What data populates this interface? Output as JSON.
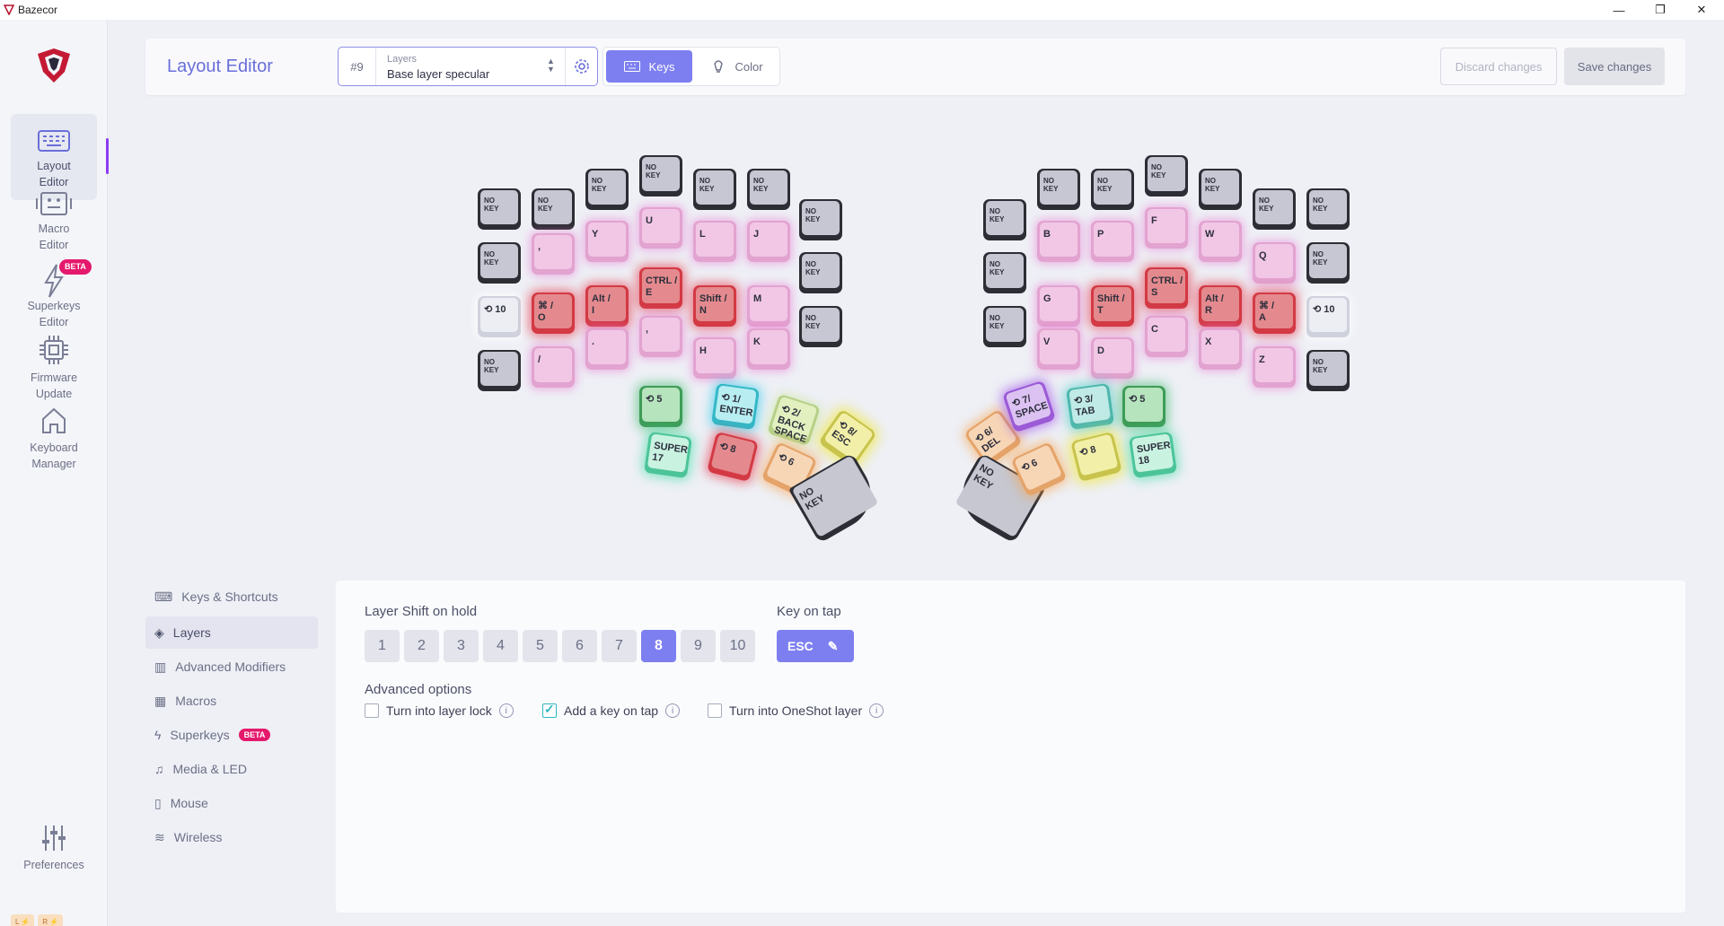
{
  "window": {
    "title": "Bazecor",
    "controls": {
      "minimize": "—",
      "maximize": "❐",
      "close": "✕"
    }
  },
  "nav": {
    "items": [
      {
        "label": "Layout\nEditor"
      },
      {
        "label": "Macro\nEditor"
      },
      {
        "label": "Superkeys\nEditor",
        "badge": "BETA"
      },
      {
        "label": "Firmware\nUpdate"
      },
      {
        "label": "Keyboard\nManager"
      }
    ],
    "preferences": "Preferences",
    "footer": [
      "L ⚡",
      "R ⚡"
    ]
  },
  "topbar": {
    "title": "Layout Editor",
    "layer_num": "#9",
    "layer_label": "Layers",
    "layer_value": "Base layer specular",
    "keys_label": "Keys",
    "color_label": "Color",
    "discard_label": "Discard changes",
    "save_label": "Save changes"
  },
  "config_menu": [
    {
      "label": "Keys & Shortcuts",
      "icon": "keyboard-icon"
    },
    {
      "label": "Layers",
      "icon": "layers-icon"
    },
    {
      "label": "Advanced Modifiers",
      "icon": "modifiers-icon"
    },
    {
      "label": "Macros",
      "icon": "macro-icon"
    },
    {
      "label": "Superkeys",
      "icon": "bolt-icon",
      "badge": "BETA"
    },
    {
      "label": "Media & LED",
      "icon": "media-icon"
    },
    {
      "label": "Mouse",
      "icon": "mouse-icon"
    },
    {
      "label": "Wireless",
      "icon": "wifi-icon"
    }
  ],
  "panel": {
    "layer_shift_title": "Layer Shift on hold",
    "layers": [
      "1",
      "2",
      "3",
      "4",
      "5",
      "6",
      "7",
      "8",
      "9",
      "10"
    ],
    "selected_layer": "8",
    "key_on_tap_title": "Key on tap",
    "key_on_tap_value": "ESC",
    "advanced_title": "Advanced options",
    "options": [
      {
        "label": "Turn into layer lock",
        "checked": false
      },
      {
        "label": "Add a key on tap",
        "checked": true
      },
      {
        "label": "Turn into OneShot layer",
        "checked": false
      }
    ]
  },
  "keyboard": {
    "left": [
      {
        "t": "NO\nKEY",
        "c": "dark",
        "s": true
      },
      {
        "t": "NO\nKEY",
        "c": "dark",
        "s": true
      },
      {
        "t": "NO\nKEY",
        "c": "dark",
        "s": true
      },
      {
        "t": "NO\nKEY",
        "c": "dark",
        "s": true
      },
      {
        "t": "NO\nKEY",
        "c": "dark",
        "s": true
      },
      {
        "t": "NO\nKEY",
        "c": "dark",
        "s": true
      },
      {
        "t": "NO\nKEY",
        "c": "dark",
        "s": true
      },
      {
        "t": "NO\nKEY",
        "c": "dark",
        "s": true
      },
      {
        "t": ",",
        "c": "pink"
      },
      {
        "t": "Y",
        "c": "pink"
      },
      {
        "t": "U",
        "c": "pink"
      },
      {
        "t": "L",
        "c": "pink"
      },
      {
        "t": "J",
        "c": "pink"
      },
      {
        "t": "NO\nKEY",
        "c": "dark",
        "s": true
      },
      {
        "t": "⟲ 10",
        "c": "white"
      },
      {
        "t": "⌘ /\nO",
        "c": "red"
      },
      {
        "t": "Alt /\nI",
        "c": "red"
      },
      {
        "t": "CTRL /\nE",
        "c": "red"
      },
      {
        "t": "Shift /\nN",
        "c": "red"
      },
      {
        "t": "M",
        "c": "pink"
      },
      {
        "t": "NO\nKEY",
        "c": "dark",
        "s": true
      },
      {
        "t": "NO\nKEY",
        "c": "dark",
        "s": true
      },
      {
        "t": "/",
        "c": "pink"
      },
      {
        "t": ".",
        "c": "pink"
      },
      {
        "t": ",",
        "c": "pink"
      },
      {
        "t": "H",
        "c": "pink"
      },
      {
        "t": "K",
        "c": "pink"
      },
      {
        "t": "⟲ 5",
        "c": "green"
      },
      {
        "t": "⟲ 1/\nENTER",
        "c": "cyan"
      },
      {
        "t": "⟲ 2/\nBACK\nSPACE",
        "c": "lime"
      },
      {
        "t": "⟲ 8/\nESC",
        "c": "yellow"
      },
      {
        "t": "SUPER\n17",
        "c": "mint"
      },
      {
        "t": "⟲ 8",
        "c": "red"
      },
      {
        "t": "⟲ 6",
        "c": "orange"
      },
      {
        "t": "NO\nKEY",
        "c": "gray"
      }
    ],
    "right": [
      {
        "t": "NO\nKEY",
        "c": "dark",
        "s": true
      },
      {
        "t": "NO\nKEY",
        "c": "dark",
        "s": true
      },
      {
        "t": "NO\nKEY",
        "c": "dark",
        "s": true
      },
      {
        "t": "NO\nKEY",
        "c": "dark",
        "s": true
      },
      {
        "t": "NO\nKEY",
        "c": "dark",
        "s": true
      },
      {
        "t": "NO\nKEY",
        "c": "dark",
        "s": true
      },
      {
        "t": "NO\nKEY",
        "c": "dark",
        "s": true
      },
      {
        "t": "NO\nKEY",
        "c": "dark",
        "s": true
      },
      {
        "t": "B",
        "c": "pink"
      },
      {
        "t": "P",
        "c": "pink"
      },
      {
        "t": "F",
        "c": "pink"
      },
      {
        "t": "W",
        "c": "pink"
      },
      {
        "t": "Q",
        "c": "pink"
      },
      {
        "t": "NO\nKEY",
        "c": "dark",
        "s": true
      },
      {
        "t": "NO\nKEY",
        "c": "dark",
        "s": true
      },
      {
        "t": "G",
        "c": "pink"
      },
      {
        "t": "Shift /\nT",
        "c": "red"
      },
      {
        "t": "CTRL /\nS",
        "c": "red"
      },
      {
        "t": "Alt /\nR",
        "c": "red"
      },
      {
        "t": "⌘ /\nA",
        "c": "red"
      },
      {
        "t": "⟲ 10",
        "c": "white"
      },
      {
        "t": "V",
        "c": "pink"
      },
      {
        "t": "D",
        "c": "pink"
      },
      {
        "t": "C",
        "c": "pink"
      },
      {
        "t": "X",
        "c": "pink"
      },
      {
        "t": "Z",
        "c": "pink"
      },
      {
        "t": "NO\nKEY",
        "c": "dark",
        "s": true
      },
      {
        "t": "⟲ 6/\nDEL",
        "c": "orange"
      },
      {
        "t": "⟲ 7/\nSPACE",
        "c": "purple"
      },
      {
        "t": "⟲ 3/\nTAB",
        "c": "teal"
      },
      {
        "t": "⟲ 5",
        "c": "green"
      },
      {
        "t": "NO\nKEY",
        "c": "gray"
      },
      {
        "t": "⟲ 6",
        "c": "orange"
      },
      {
        "t": "⟲ 8",
        "c": "yellow"
      },
      {
        "t": "SUPER\n18",
        "c": "mint"
      }
    ]
  },
  "colors": {
    "accent": "#7d7ff0",
    "brand": "#b4122c",
    "beta": "#e5196c"
  }
}
